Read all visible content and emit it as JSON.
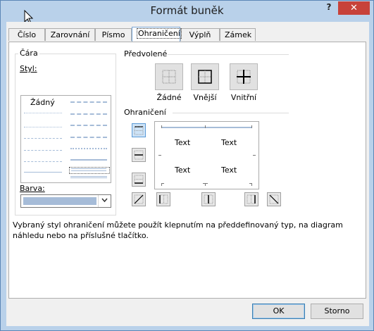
{
  "window": {
    "title": "Formát buněk",
    "help": "?",
    "close": "✕"
  },
  "tabs": [
    {
      "label": "Číslo"
    },
    {
      "label": "Zarovnání"
    },
    {
      "label": "Písmo"
    },
    {
      "label": "Ohraničení"
    },
    {
      "label": "Výplň"
    },
    {
      "label": "Zámek"
    }
  ],
  "active_tab": "Ohraničení",
  "line_group": {
    "legend": "Čára",
    "style_label": "Styl:",
    "style_none": "Žádný",
    "color_label": "Barva:",
    "color_value": "#a6bcd8"
  },
  "presets": {
    "legend": "Předvolené",
    "items": [
      {
        "label": "Žádné"
      },
      {
        "label": "Vnější"
      },
      {
        "label": "Vnitřní"
      }
    ]
  },
  "border": {
    "legend": "Ohraničení",
    "preview_text": [
      "Text",
      "Text",
      "Text",
      "Text"
    ]
  },
  "description": "Vybraný styl ohraničení můžete použít klepnutím na předdefinovaný typ, na diagram náhledu nebo na příslušné tlačítko.",
  "buttons": {
    "ok": "OK",
    "cancel": "Storno"
  }
}
